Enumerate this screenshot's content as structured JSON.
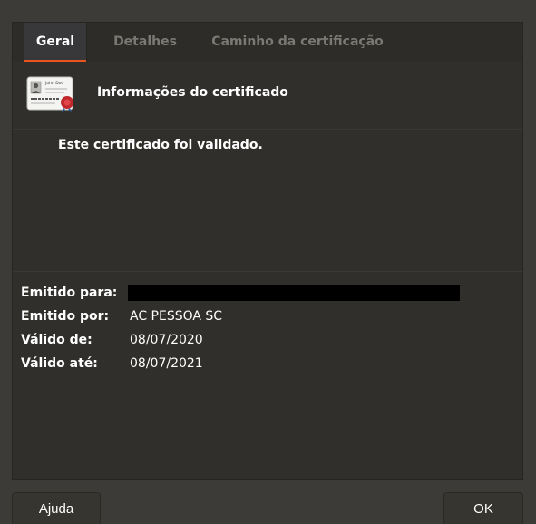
{
  "tabs": [
    {
      "label": "Geral",
      "active": true
    },
    {
      "label": "Detalhes",
      "active": false
    },
    {
      "label": "Caminho da certificação",
      "active": false
    }
  ],
  "header": {
    "icon": "certificate-icon",
    "icon_name_text": "John Doe",
    "title": "Informações do certificado"
  },
  "status": "Este certificado foi validado.",
  "info": {
    "issued_to_label": "Emitido para:",
    "issued_to_value": "",
    "issued_by_label": "Emitido por:",
    "issued_by_value": "AC PESSOA SC",
    "valid_from_label": "Válido de:",
    "valid_from_value": "08/07/2020",
    "valid_until_label": "Válido até:",
    "valid_until_value": "08/07/2021"
  },
  "buttons": {
    "help": "Ajuda",
    "ok": "OK"
  },
  "colors": {
    "accent": "#e95420",
    "background": "#3c3b37",
    "panel": "#302f2b"
  }
}
